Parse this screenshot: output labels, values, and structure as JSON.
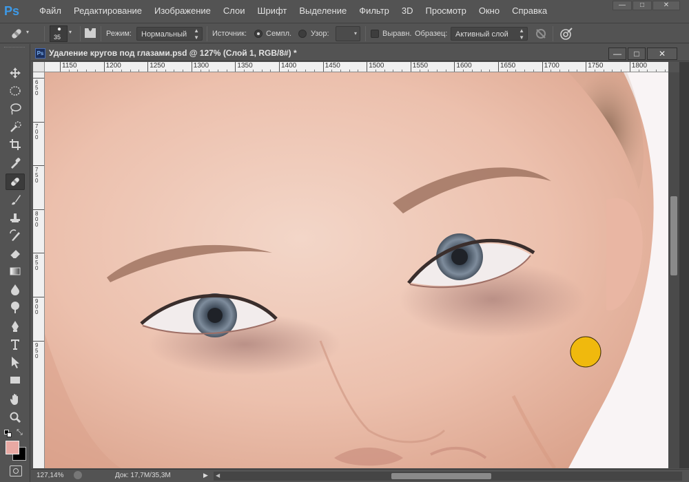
{
  "app": {
    "logo": "Ps",
    "menu": [
      "Файл",
      "Редактирование",
      "Изображение",
      "Слои",
      "Шрифт",
      "Выделение",
      "Фильтр",
      "3D",
      "Просмотр",
      "Окно",
      "Справка"
    ],
    "window_controls": [
      "—",
      "□",
      "✕"
    ]
  },
  "options_bar": {
    "tool_icon": "healing-brush-icon",
    "brush_size": "35",
    "mode_label": "Режим:",
    "mode_value": "Нормальный",
    "source_label": "Источник:",
    "source_sampled_label": "Семпл.",
    "source_pattern_label": "Узор:",
    "source_selected": "Семпл.",
    "aligned_label": "Выравн.",
    "aligned_checked": false,
    "sample_label": "Образец:",
    "sample_value": "Активный слой"
  },
  "tools": [
    {
      "name": "move",
      "icon": "move-icon"
    },
    {
      "name": "marquee",
      "icon": "elliptical-marquee-icon"
    },
    {
      "name": "lasso",
      "icon": "lasso-icon"
    },
    {
      "name": "quick-selection",
      "icon": "quick-selection-icon"
    },
    {
      "name": "crop",
      "icon": "crop-icon"
    },
    {
      "name": "eyedropper",
      "icon": "eyedropper-icon"
    },
    {
      "name": "healing-brush",
      "icon": "healing-brush-icon",
      "active": true
    },
    {
      "name": "brush",
      "icon": "brush-icon"
    },
    {
      "name": "clone-stamp",
      "icon": "clone-stamp-icon"
    },
    {
      "name": "history-brush",
      "icon": "history-brush-icon"
    },
    {
      "name": "eraser",
      "icon": "eraser-icon"
    },
    {
      "name": "gradient",
      "icon": "gradient-icon"
    },
    {
      "name": "blur",
      "icon": "blur-icon"
    },
    {
      "name": "dodge",
      "icon": "dodge-icon"
    },
    {
      "name": "pen",
      "icon": "pen-icon"
    },
    {
      "name": "type",
      "icon": "type-icon"
    },
    {
      "name": "path-selection",
      "icon": "path-selection-icon"
    },
    {
      "name": "rectangle",
      "icon": "rectangle-shape-icon"
    },
    {
      "name": "hand",
      "icon": "hand-icon"
    },
    {
      "name": "zoom",
      "icon": "zoom-icon"
    }
  ],
  "colors": {
    "foreground": "#e8a9a3",
    "background": "#000000",
    "brush_cursor": "#f0b90d",
    "ui_bg": "#535353"
  },
  "document": {
    "title": "Удаление кругов под глазами.psd @ 127% (Слой 1, RGB/8#) *",
    "ruler_h": [
      "1150",
      "1200",
      "1250",
      "1300",
      "1350",
      "1400",
      "1450",
      "1500",
      "1550",
      "1600",
      "1650",
      "1700",
      "1750",
      "1800"
    ],
    "ruler_v": [
      "650",
      "700",
      "750",
      "800",
      "850",
      "900",
      "950"
    ]
  },
  "status": {
    "zoom": "127,14%",
    "doc_info": "Док: 17,7M/35,3M"
  }
}
